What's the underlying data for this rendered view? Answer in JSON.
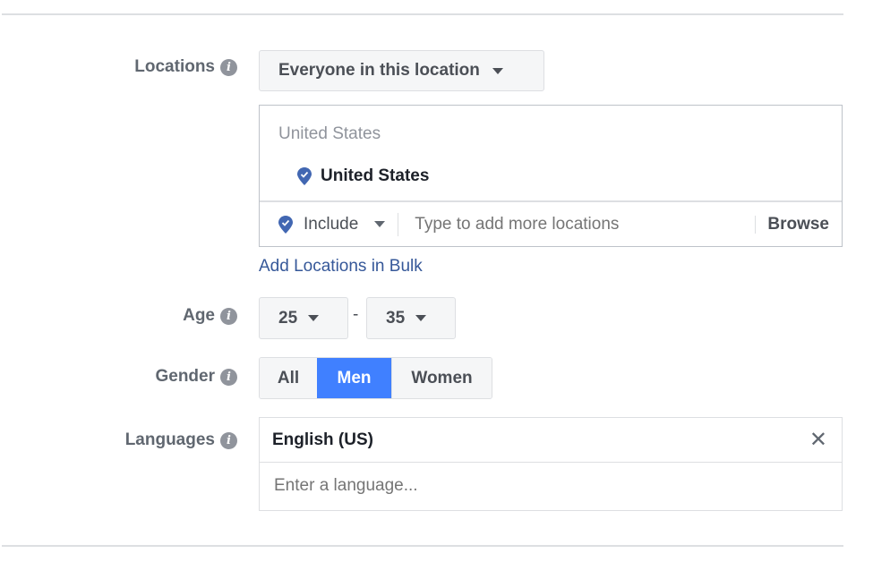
{
  "locations": {
    "label": "Locations",
    "audience_dropdown": "Everyone in this location",
    "group_heading": "United States",
    "selected_location": "United States",
    "include_dropdown": "Include",
    "search_placeholder": "Type to add more locations",
    "browse_label": "Browse",
    "bulk_link": "Add Locations in Bulk"
  },
  "age": {
    "label": "Age",
    "min": "25",
    "separator": "-",
    "max": "35"
  },
  "gender": {
    "label": "Gender",
    "options": [
      "All",
      "Men",
      "Women"
    ],
    "selected": "Men"
  },
  "languages": {
    "label": "Languages",
    "selected": "English (US)",
    "placeholder": "Enter a language..."
  },
  "colors": {
    "accent": "#4080ff",
    "link": "#365899",
    "pin": "#4267b2"
  }
}
